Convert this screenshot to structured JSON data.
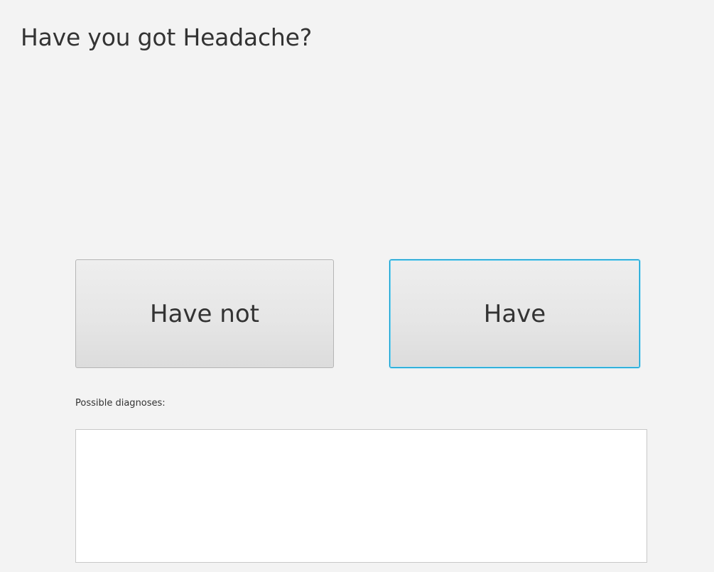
{
  "question": {
    "text": "Have you got Headache?"
  },
  "answers": {
    "no_label": "Have not",
    "yes_label": "Have"
  },
  "diagnoses": {
    "label": "Possible diagnoses:",
    "value": ""
  },
  "colors": {
    "background": "#f3f3f3",
    "focus_accent": "#0096c9",
    "text": "#333333"
  }
}
